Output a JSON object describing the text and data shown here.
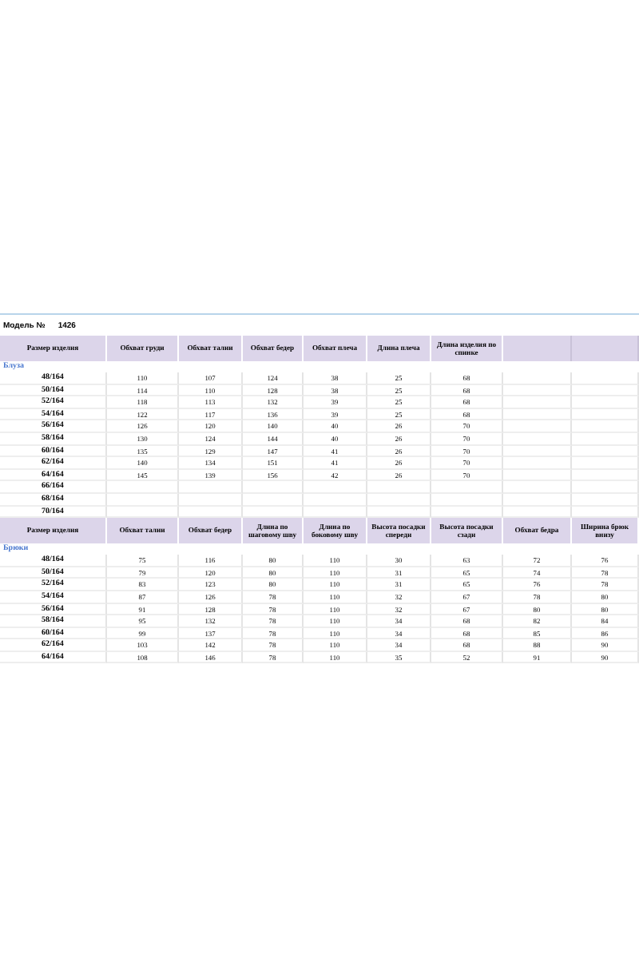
{
  "model": {
    "label": "Модель №",
    "number": "1426"
  },
  "sections": [
    {
      "columns": [
        "Размер изделия",
        "Обхват груди",
        "Обхват талии",
        "Обхват бедер",
        "Обхват плеча",
        "Длина плеча",
        "Длина изделия по спинке"
      ],
      "name": "Блуза",
      "rows": [
        {
          "size": "48/164",
          "values": [
            "110",
            "107",
            "124",
            "38",
            "25",
            "68"
          ]
        },
        {
          "size": "50/164",
          "values": [
            "114",
            "110",
            "128",
            "38",
            "25",
            "68"
          ]
        },
        {
          "size": "52/164",
          "values": [
            "118",
            "113",
            "132",
            "39",
            "25",
            "68"
          ]
        },
        {
          "size": "54/164",
          "values": [
            "122",
            "117",
            "136",
            "39",
            "25",
            "68"
          ]
        },
        {
          "size": "56/164",
          "values": [
            "126",
            "120",
            "140",
            "40",
            "26",
            "70"
          ]
        },
        {
          "size": "58/164",
          "values": [
            "130",
            "124",
            "144",
            "40",
            "26",
            "70"
          ]
        },
        {
          "size": "60/164",
          "values": [
            "135",
            "129",
            "147",
            "41",
            "26",
            "70"
          ]
        },
        {
          "size": "62/164",
          "values": [
            "140",
            "134",
            "151",
            "41",
            "26",
            "70"
          ]
        },
        {
          "size": "64/164",
          "values": [
            "145",
            "139",
            "156",
            "42",
            "26",
            "70"
          ]
        },
        {
          "size": "66/164"
        },
        {
          "size": "68/164"
        },
        {
          "size": "70/164"
        }
      ]
    },
    {
      "columns": [
        "Размер изделия",
        "Обхват талии",
        "Обхват бедер",
        "Длина по шаговому шву",
        "Длина по боковому шву",
        "Высота посадки спереди",
        "Высота посадки сзади",
        "Обхват бедра",
        "Ширина брюк внизу"
      ],
      "name": "Брюки",
      "rows": [
        {
          "size": "48/164",
          "values": [
            "75",
            "116",
            "80",
            "110",
            "30",
            "63",
            "72",
            "76"
          ]
        },
        {
          "size": "50/164",
          "values": [
            "79",
            "120",
            "80",
            "110",
            "31",
            "65",
            "74",
            "78"
          ]
        },
        {
          "size": "52/164",
          "values": [
            "83",
            "123",
            "80",
            "110",
            "31",
            "65",
            "76",
            "78"
          ]
        },
        {
          "size": "54/164",
          "values": [
            "87",
            "126",
            "78",
            "110",
            "32",
            "67",
            "78",
            "80"
          ]
        },
        {
          "size": "56/164",
          "values": [
            "91",
            "128",
            "78",
            "110",
            "32",
            "67",
            "80",
            "80"
          ]
        },
        {
          "size": "58/164",
          "values": [
            "95",
            "132",
            "78",
            "110",
            "34",
            "68",
            "82",
            "84"
          ]
        },
        {
          "size": "60/164",
          "values": [
            "99",
            "137",
            "78",
            "110",
            "34",
            "68",
            "85",
            "86"
          ]
        },
        {
          "size": "62/164",
          "values": [
            "103",
            "142",
            "78",
            "110",
            "34",
            "68",
            "88",
            "90"
          ]
        },
        {
          "size": "64/164",
          "values": [
            "108",
            "146",
            "78",
            "110",
            "35",
            "52",
            "91",
            "90"
          ]
        }
      ]
    }
  ]
}
